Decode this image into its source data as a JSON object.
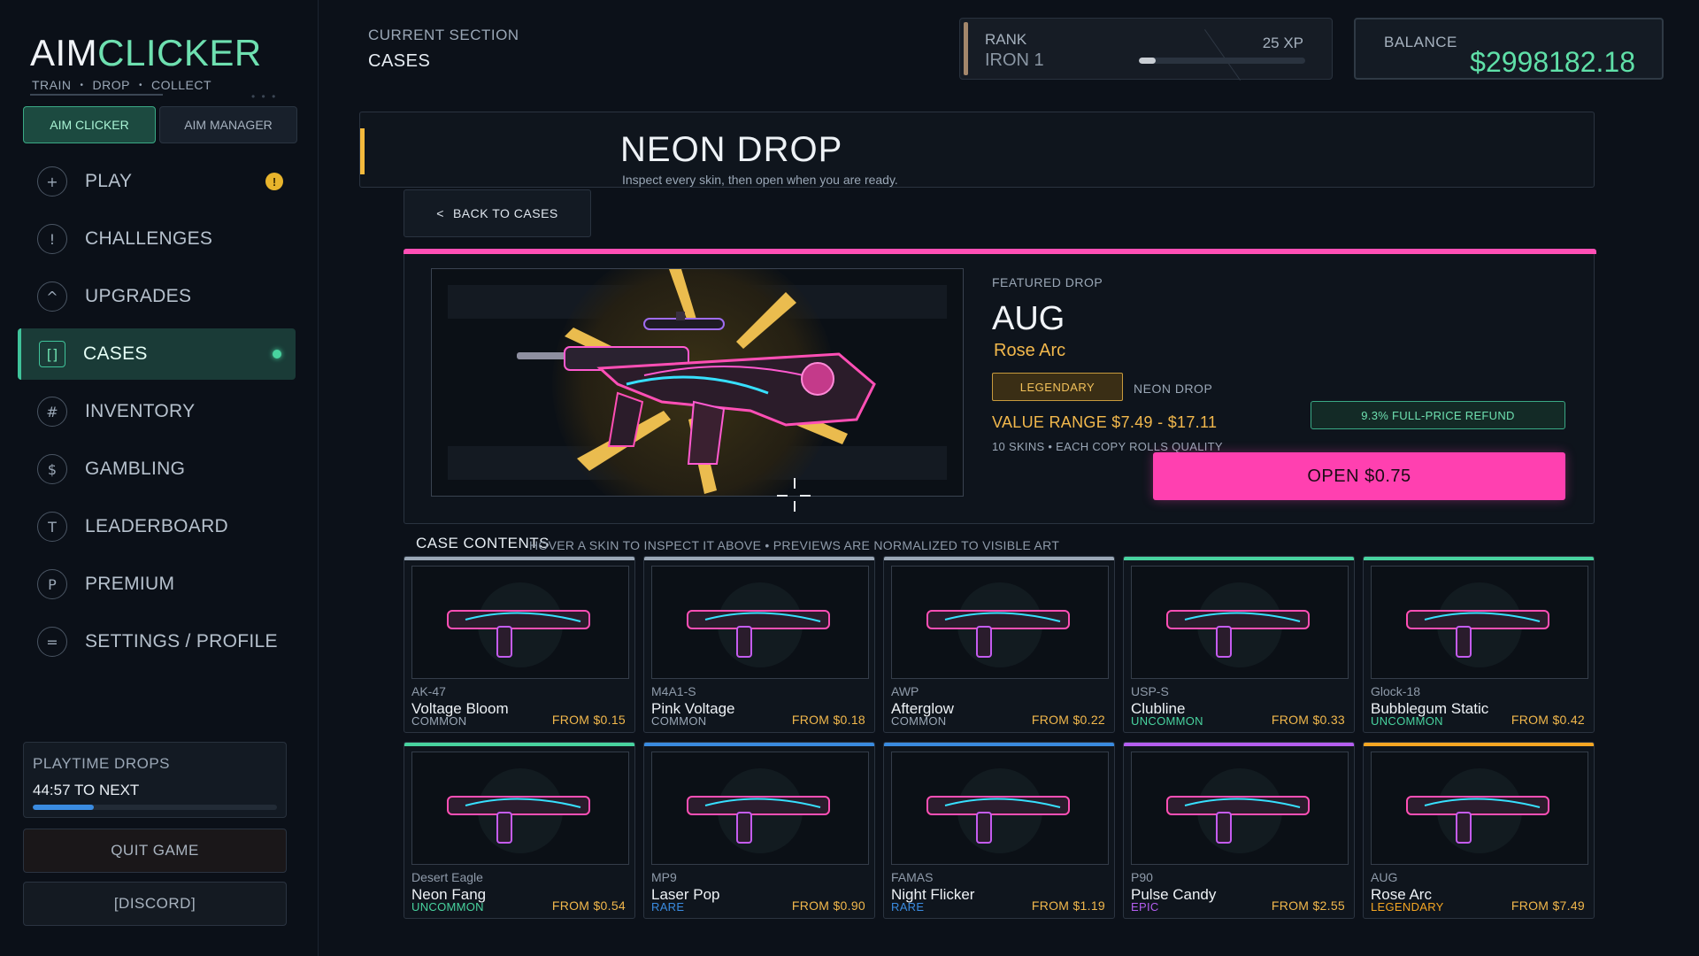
{
  "colors": {
    "accent_green": "#3fc39a",
    "balance_green": "#5fe0a8",
    "gold": "#f2b84c",
    "pink": "#ff40b0",
    "common": "#9aa7b6",
    "uncommon": "#48d39f",
    "rare": "#3a8be0",
    "epic": "#b45ef0",
    "legendary": "#f5a623"
  },
  "logo": {
    "part1": "AIM",
    "part2": "CLICKER"
  },
  "tagline": {
    "w1": "TRAIN",
    "w2": "DROP",
    "w3": "COLLECT",
    "sep": "•"
  },
  "tabs": {
    "aim_clicker": "AIM CLICKER",
    "aim_manager": "AIM MANAGER"
  },
  "nav": [
    {
      "icon": "+",
      "icon_name": "plus-icon",
      "label": "PLAY"
    },
    {
      "icon": "!",
      "icon_name": "exclamation-icon",
      "label": "CHALLENGES"
    },
    {
      "icon": "^",
      "icon_name": "caret-up-icon",
      "label": "UPGRADES"
    },
    {
      "icon": "[]",
      "icon_name": "brackets-icon",
      "label": "CASES"
    },
    {
      "icon": "#",
      "icon_name": "hash-icon",
      "label": "INVENTORY"
    },
    {
      "icon": "$",
      "icon_name": "dollar-icon",
      "label": "GAMBLING"
    },
    {
      "icon": "T",
      "icon_name": "trophy-letter-icon",
      "label": "LEADERBOARD"
    },
    {
      "icon": "P",
      "icon_name": "premium-letter-icon",
      "label": "PREMIUM"
    },
    {
      "icon": "=",
      "icon_name": "menu-lines-icon",
      "label": "SETTINGS / PROFILE"
    }
  ],
  "play_alert": "!",
  "playtime": {
    "label": "PLAYTIME DROPS",
    "value": "44:57 TO NEXT",
    "progress": 0.25
  },
  "quit_label": "QUIT GAME",
  "discord_label": "[DISCORD]",
  "header": {
    "current_section_label": "CURRENT SECTION",
    "current_section": "CASES"
  },
  "rank": {
    "label": "RANK",
    "value": "IRON 1",
    "xp": "25 XP",
    "progress": 0.1
  },
  "balance": {
    "label": "BALANCE",
    "value": "$2998182.18"
  },
  "case": {
    "title": "NEON DROP",
    "subtitle": "Inspect every skin, then open when you are ready.",
    "back_label": "BACK TO CASES",
    "back_glyph": "<"
  },
  "featured": {
    "label": "FEATURED DROP",
    "weapon": "AUG",
    "skin": "Rose Arc",
    "rarity": "LEGENDARY",
    "case_tag": "NEON DROP",
    "value_range": "VALUE RANGE  $7.49 - $17.11",
    "skins_meta": "10 SKINS  •  EACH COPY ROLLS QUALITY",
    "refund": "9.3% FULL-PRICE REFUND",
    "open_label": "OPEN  $0.75"
  },
  "contents": {
    "title": "CASE CONTENTS",
    "hint": "HOVER A SKIN TO INSPECT IT ABOVE  •  PREVIEWS ARE NORMALIZED TO VISIBLE ART",
    "items": [
      {
        "weapon": "AK-47",
        "skin": "Voltage Bloom",
        "rarity": "COMMON",
        "price": "FROM $0.15",
        "rarity_color": "#9aa7b6",
        "icon_name": "ak47-icon"
      },
      {
        "weapon": "M4A1-S",
        "skin": "Pink Voltage",
        "rarity": "COMMON",
        "price": "FROM $0.18",
        "rarity_color": "#9aa7b6",
        "icon_name": "m4a1s-icon"
      },
      {
        "weapon": "AWP",
        "skin": "Afterglow",
        "rarity": "COMMON",
        "price": "FROM $0.22",
        "rarity_color": "#9aa7b6",
        "icon_name": "awp-icon"
      },
      {
        "weapon": "USP-S",
        "skin": "Clubline",
        "rarity": "UNCOMMON",
        "price": "FROM $0.33",
        "rarity_color": "#48d39f",
        "icon_name": "usps-icon"
      },
      {
        "weapon": "Glock-18",
        "skin": "Bubblegum Static",
        "rarity": "UNCOMMON",
        "price": "FROM $0.42",
        "rarity_color": "#48d39f",
        "icon_name": "glock-icon"
      },
      {
        "weapon": "Desert Eagle",
        "skin": "Neon Fang",
        "rarity": "UNCOMMON",
        "price": "FROM $0.54",
        "rarity_color": "#48d39f",
        "icon_name": "deagle-icon"
      },
      {
        "weapon": "MP9",
        "skin": "Laser Pop",
        "rarity": "RARE",
        "price": "FROM $0.90",
        "rarity_color": "#3a8be0",
        "icon_name": "mp9-icon"
      },
      {
        "weapon": "FAMAS",
        "skin": "Night Flicker",
        "rarity": "RARE",
        "price": "FROM $1.19",
        "rarity_color": "#3a8be0",
        "icon_name": "famas-icon"
      },
      {
        "weapon": "P90",
        "skin": "Pulse Candy",
        "rarity": "EPIC",
        "price": "FROM $2.55",
        "rarity_color": "#b45ef0",
        "icon_name": "p90-icon"
      },
      {
        "weapon": "AUG",
        "skin": "Rose Arc",
        "rarity": "LEGENDARY",
        "price": "FROM $7.49",
        "rarity_color": "#f5a623",
        "icon_name": "aug-icon"
      }
    ]
  }
}
